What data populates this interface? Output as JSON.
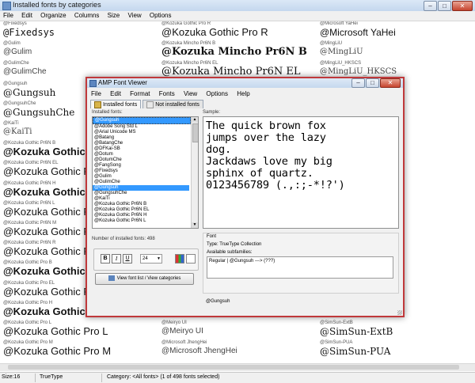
{
  "background_window": {
    "title": "Installed fonts by categories",
    "menu": [
      "File",
      "Edit",
      "Organize",
      "Columns",
      "Size",
      "View",
      "Options"
    ],
    "controls": {
      "minimize": "–",
      "maximize": "□",
      "close": "✕"
    },
    "grid": [
      [
        {
          "label": "@Fixedsys",
          "sample": "@Fixedsys"
        },
        {
          "label": "@Gulim",
          "sample": "@Gulim"
        },
        {
          "label": "@GulimChe",
          "sample": "@GulimChe"
        },
        {
          "label": "@Gungsuh",
          "sample": "@Gungsuh"
        },
        {
          "label": "@GungsuhChe",
          "sample": "@GungsuhChe"
        },
        {
          "label": "@KaiTi",
          "sample": "@KaiTi"
        },
        {
          "label": "@Kozuka Gothic Pr6N B",
          "sample": "@Kozuka Gothic Pr6N B"
        },
        {
          "label": "@Kozuka Gothic Pr6N EL",
          "sample": "@Kozuka Gothic Pr6N EL"
        },
        {
          "label": "@Kozuka Gothic Pr6N H",
          "sample": "@Kozuka Gothic Pr6N H"
        },
        {
          "label": "@Kozuka Gothic Pr6N L",
          "sample": "@Kozuka Gothic Pr6N L"
        },
        {
          "label": "@Kozuka Gothic Pr6N M",
          "sample": "@Kozuka Gothic Pr6N M"
        },
        {
          "label": "@Kozuka Gothic Pr6N R",
          "sample": "@Kozuka Gothic Pr6N R"
        },
        {
          "label": "@Kozuka Gothic Pro B",
          "sample": "@Kozuka Gothic Pro B"
        },
        {
          "label": "@Kozuka Gothic Pro EL",
          "sample": "@Kozuka Gothic Pro EL"
        },
        {
          "label": "@Kozuka Gothic Pro H",
          "sample": "@Kozuka Gothic Pro H"
        },
        {
          "label": "@Kozuka Gothic Pro L",
          "sample": "@Kozuka Gothic Pro L"
        },
        {
          "label": "@Kozuka Gothic Pro M",
          "sample": "@Kozuka Gothic Pro M"
        }
      ],
      [
        {
          "label": "@Kozuka Gothic Pro R",
          "sample": "@Kozuka Gothic Pro R"
        },
        {
          "label": "@Kozuka Mincho Pr6N B",
          "sample": "@Kozuka Mincho Pr6N B"
        },
        {
          "label": "@Kozuka Mincho Pr6N EL",
          "sample": "@Kozuka Mincho Pr6N EL"
        },
        {
          "label": "",
          "sample": ""
        },
        {
          "label": "",
          "sample": ""
        },
        {
          "label": "",
          "sample": ""
        },
        {
          "label": "",
          "sample": ""
        },
        {
          "label": "",
          "sample": ""
        },
        {
          "label": "",
          "sample": ""
        },
        {
          "label": "",
          "sample": ""
        },
        {
          "label": "",
          "sample": ""
        },
        {
          "label": "",
          "sample": ""
        },
        {
          "label": "",
          "sample": ""
        },
        {
          "label": "",
          "sample": ""
        },
        {
          "label": "",
          "sample": ""
        },
        {
          "label": "@Meiryo UI",
          "sample": "@Meiryo UI"
        },
        {
          "label": "@Microsoft JhengHei",
          "sample": "@Microsoft JhengHei"
        }
      ],
      [
        {
          "label": "@Microsoft YaHei",
          "sample": "@Microsoft YaHei"
        },
        {
          "label": "@MingLiU",
          "sample": "@MingLiU"
        },
        {
          "label": "@MingLiU_HKSCS",
          "sample": "@MingLiU_HKSCS"
        },
        {
          "label": "",
          "sample": ""
        },
        {
          "label": "",
          "sample": ""
        },
        {
          "label": "",
          "sample": ""
        },
        {
          "label": "",
          "sample": ""
        },
        {
          "label": "",
          "sample": ""
        },
        {
          "label": "",
          "sample": ""
        },
        {
          "label": "",
          "sample": ""
        },
        {
          "label": "",
          "sample": ""
        },
        {
          "label": "",
          "sample": ""
        },
        {
          "label": "",
          "sample": ""
        },
        {
          "label": "",
          "sample": ""
        },
        {
          "label": "",
          "sample": ""
        },
        {
          "label": "@SimSun-ExtB",
          "sample": "@SimSun-ExtB"
        },
        {
          "label": "@SimSun-PUA",
          "sample": "@SimSun-PUA"
        }
      ]
    ],
    "status": {
      "size": "Size:16",
      "type": "TrueType",
      "category": "Category: <All fonts> (1 of 498 fonts selected)"
    }
  },
  "dialog": {
    "title": "AMP Font Viewer",
    "menu": [
      "File",
      "Edit",
      "Format",
      "Fonts",
      "View",
      "Options",
      "Help"
    ],
    "tabs": {
      "installed": "Installed fonts",
      "not_installed": "Not installed fonts"
    },
    "installed_label": "Installed fonts:",
    "font_list": [
      "@Gungsuh",
      "@Adobe Song Std L",
      "@Arial Unicode MS",
      "@Batang",
      "@BatangChe",
      "@DFKai-SB",
      "@Dotum",
      "@DotumChe",
      "@FangSong",
      "@Fixedsys",
      "@Gulim",
      "@GulimChe",
      "@Gungsuh",
      "@GungsuhChe",
      "@KaiTi",
      "@Kozuka Gothic Pr6N B",
      "@Kozuka Gothic Pr6N EL",
      "@Kozuka Gothic Pr6N H",
      "@Kozuka Gothic Pr6N L"
    ],
    "count_label": "Number of installed fonts:  498",
    "format": {
      "bold": "B",
      "italic": "I",
      "underline": "U",
      "size": "24"
    },
    "view_button": "View font list / View categories",
    "sample_label": "Sample:",
    "sample_text": "The quick brown fox\njumps over the lazy\ndog.\nJackdaws love my big\nsphinx of quartz.\n0123456789 (.,:;-*!?')",
    "font_group": {
      "title": "Font",
      "type": "Type:  TrueType Collection",
      "subfamilies_label": "Available subfamilies:",
      "subfamilies_value": "Regular   |   @Gungsuh   --->   (???)"
    },
    "status_name": "@Gungsuh",
    "accent": "#3399ff",
    "border": "#c0393b"
  }
}
